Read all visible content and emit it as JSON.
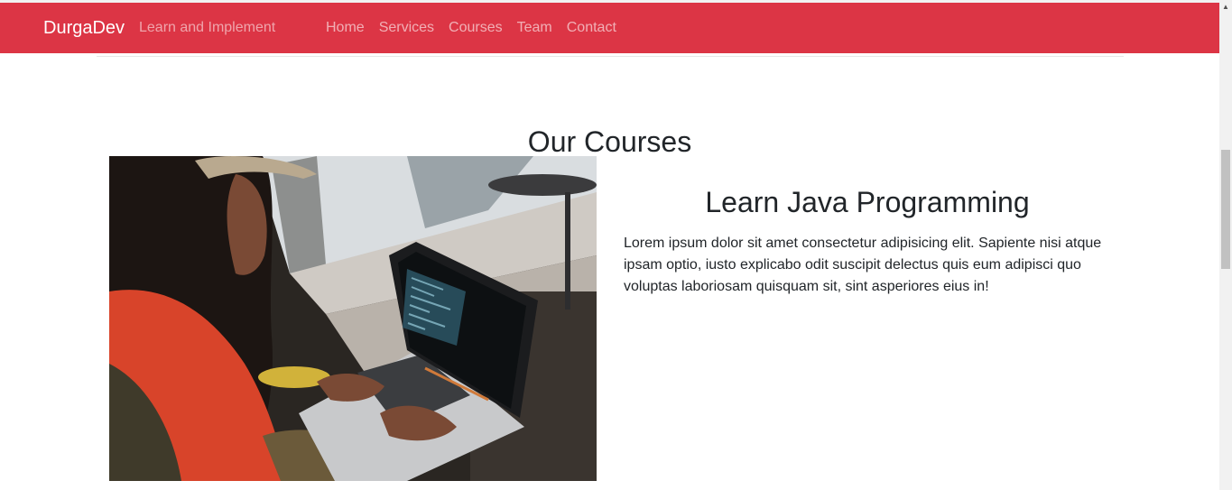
{
  "navbar": {
    "brand": "DurgaDev",
    "tagline": "Learn and Implement",
    "links": [
      "Home",
      "Services",
      "Courses",
      "Team",
      "Contact"
    ],
    "background": "#dc3545"
  },
  "section": {
    "title": "Our Courses"
  },
  "course": {
    "title": "Learn Java Programming",
    "description": "Lorem ipsum dolor sit amet consectetur adipisicing elit. Sapiente nisi atque ipsam optio, iusto explicabo odit suscipit delectus quis eum adipisci quo voluptas laboriosam quisquam sit, sint asperiores eius in!",
    "image": "person-coding-on-laptop-photo"
  },
  "scrollbar": {
    "up_icon": "▲"
  }
}
